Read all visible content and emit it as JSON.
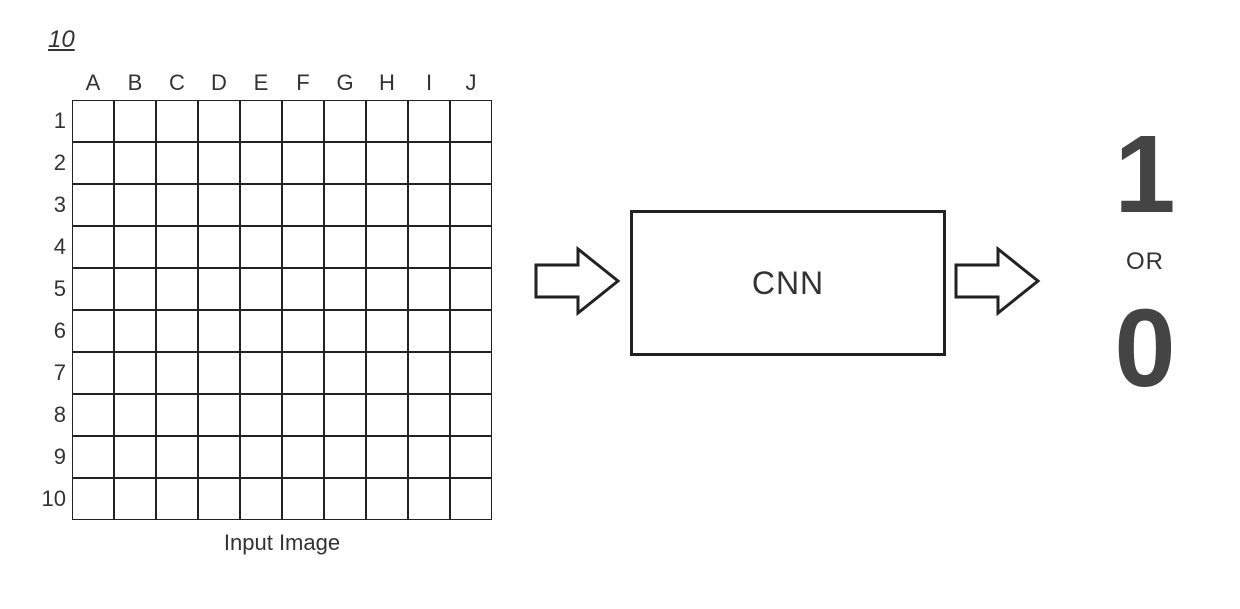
{
  "figure_number": "10",
  "grid": {
    "columns": [
      "A",
      "B",
      "C",
      "D",
      "E",
      "F",
      "G",
      "H",
      "I",
      "J"
    ],
    "rows": [
      "1",
      "2",
      "3",
      "4",
      "5",
      "6",
      "7",
      "8",
      "9",
      "10"
    ],
    "caption": "Input Image"
  },
  "processor": {
    "label": "CNN"
  },
  "output": {
    "one": "1",
    "or": "OR",
    "zero": "0"
  }
}
